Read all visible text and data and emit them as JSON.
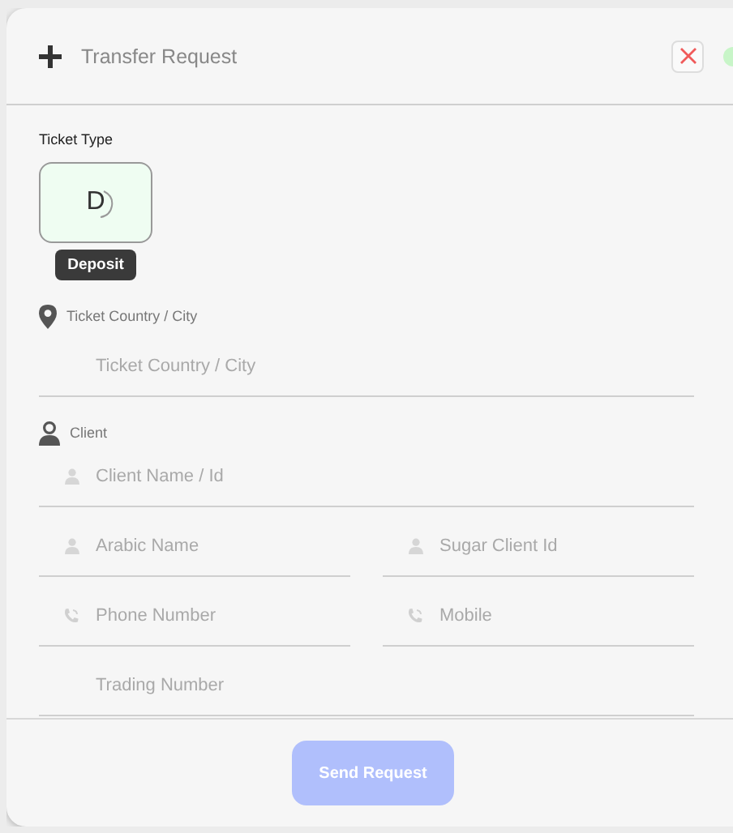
{
  "dialog": {
    "title": "Transfer Request"
  },
  "ticket_type": {
    "label": "Ticket Type",
    "options": [
      {
        "letter": "D",
        "tooltip": "Deposit",
        "selected": true
      }
    ]
  },
  "sections": [
    {
      "label": "Ticket Country / City",
      "rows": [
        [
          {
            "placeholder": "Ticket Country / City",
            "kind": "plain"
          }
        ]
      ]
    },
    {
      "label": "Client",
      "rows": [
        [
          {
            "placeholder": "Client Name / Id",
            "kind": "name"
          }
        ],
        [
          {
            "placeholder": "Arabic Name",
            "kind": "name"
          },
          {
            "placeholder": "Sugar Client Id",
            "kind": "name"
          }
        ],
        [
          {
            "placeholder": "Phone Number",
            "kind": "phone"
          },
          {
            "placeholder": "Mobile",
            "kind": "phone"
          }
        ],
        [
          {
            "placeholder": "Trading Number",
            "kind": "plain"
          }
        ]
      ]
    }
  ],
  "submit": {
    "label": "Send Request",
    "disabled": true
  }
}
